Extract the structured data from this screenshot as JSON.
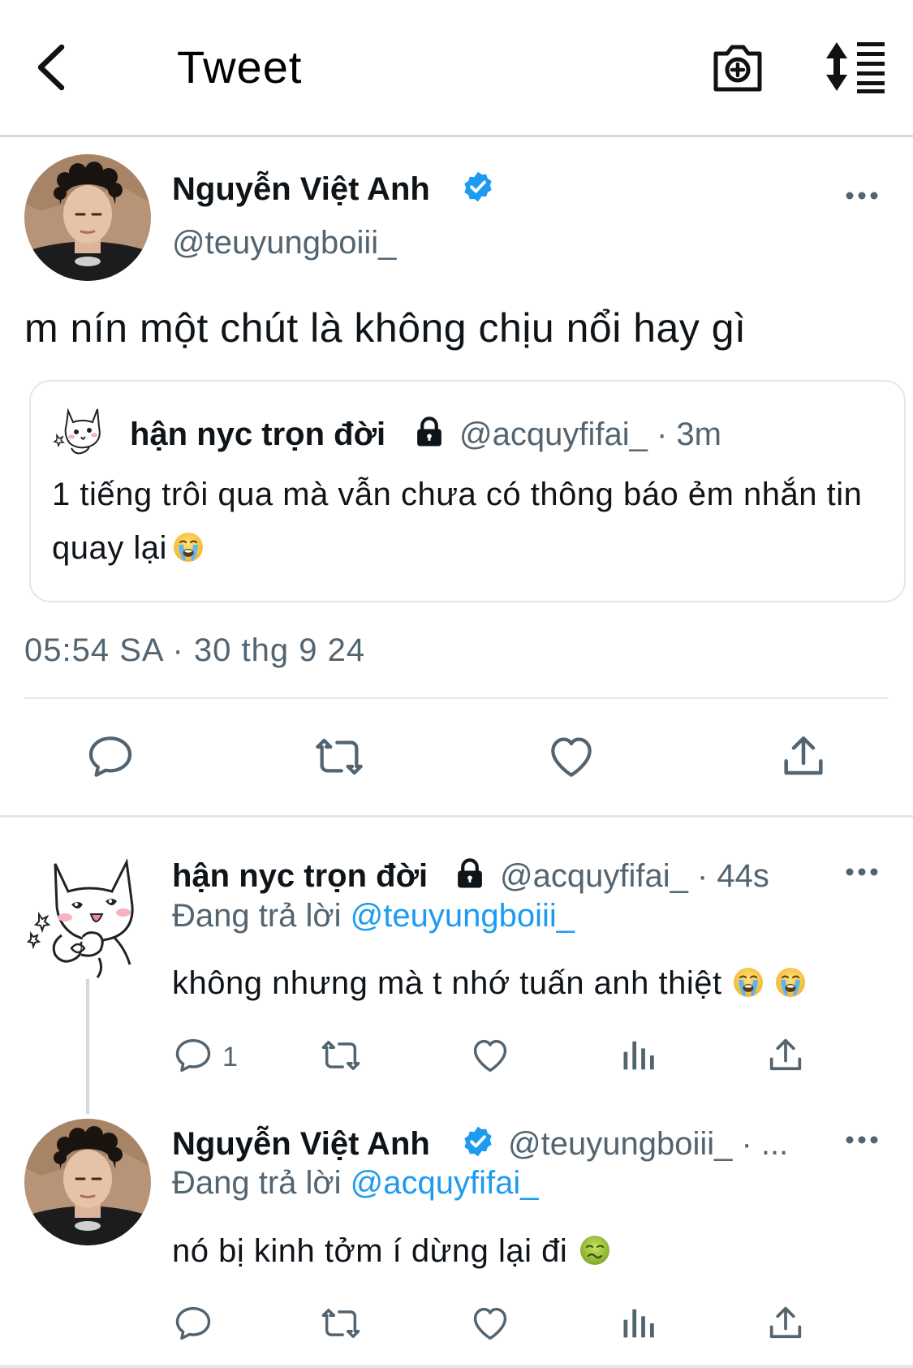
{
  "header": {
    "title": "Tweet",
    "icons": [
      "back-arrow-icon",
      "camera-plus-icon",
      "sort-lines-icon"
    ]
  },
  "main_tweet": {
    "author_name": "Nguyễn Việt Anh",
    "handle": "@teuyungboiii_",
    "text": "m nín một chút là không chịu nổi hay gì",
    "timestamp": "05:54 SA · 30 thg 9 24",
    "quote": {
      "author_name": "hận nyc trọn đời",
      "meta": "@acquyfifai_ · 3m",
      "text": "1 tiếng trôi qua mà vẫn chưa có thông báo ẻm nhắn tin quay lại",
      "emoji": "loudly-crying-emoji"
    }
  },
  "replies": [
    {
      "author_name": "hận nyc trọn đời",
      "meta": "@acquyfifai_ · 44s",
      "replying_prefix": "Đang trả lời",
      "replying_to": "@teuyungboiii_",
      "text": "không nhưng mà t nhớ tuấn anh thiệt",
      "emojis": [
        "loudly-crying-emoji",
        "loudly-crying-emoji"
      ],
      "reply_count": "1"
    },
    {
      "author_name": "Nguyễn Việt Anh",
      "meta": "@teuyungboiii_ · ...",
      "replying_prefix": "Đang trả lời",
      "replying_to": "@acquyfifai_",
      "text": "nó bị kinh tởm í dừng lại đi",
      "emojis": [
        "nauseated-face-emoji"
      ]
    }
  ],
  "colors": {
    "text": "#0f1419",
    "secondary": "#536471",
    "accent": "#1d9bf0",
    "divider": "#e3e7ea"
  }
}
